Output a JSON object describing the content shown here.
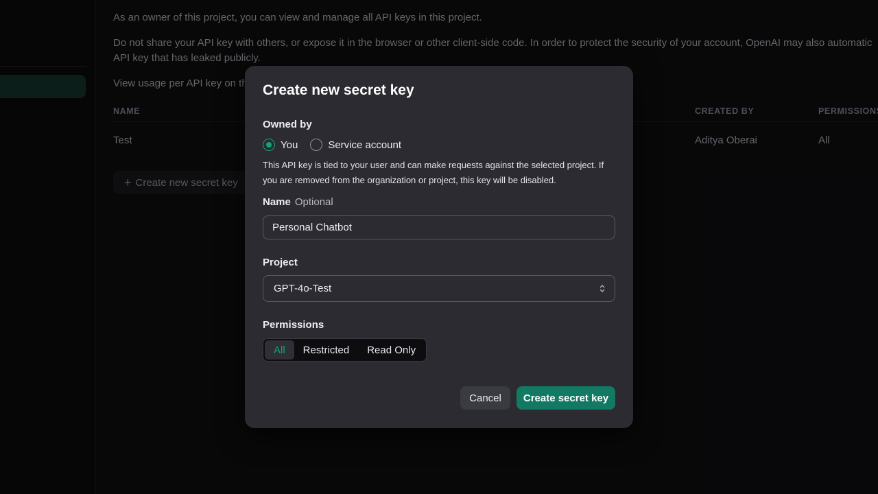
{
  "background": {
    "intro_1": "As an owner of this project, you can view and manage all API keys in this project.",
    "intro_2a": "Do not share your API key with others, or expose it in the browser or other client-side code. In order to protect the security of your account, OpenAI may also automatic",
    "intro_2b": "API key that has leaked publicly.",
    "intro_3": "View usage per API key on th",
    "table": {
      "headers": {
        "name": "NAME",
        "created_by": "CREATED BY",
        "permissions": "PERMISSIONS"
      },
      "rows": [
        {
          "name": "Test",
          "created_by": "Aditya Oberai",
          "permissions": "All"
        }
      ]
    },
    "create_button_label": "Create new secret key"
  },
  "modal": {
    "title": "Create new secret key",
    "owned_by": {
      "label": "Owned by",
      "options": [
        "You",
        "Service account"
      ],
      "selected": "You",
      "help": "This API key is tied to your user and can make requests against the selected project. If you are removed from the organization or project, this key will be disabled."
    },
    "name": {
      "label": "Name",
      "optional": "Optional",
      "value": "Personal Chatbot"
    },
    "project": {
      "label": "Project",
      "value": "GPT-4o-Test"
    },
    "permissions": {
      "label": "Permissions",
      "options": [
        "All",
        "Restricted",
        "Read Only"
      ],
      "selected": "All"
    },
    "actions": {
      "cancel": "Cancel",
      "submit": "Create secret key"
    }
  },
  "colors": {
    "accent": "#10a37f",
    "primary_button": "#127a63",
    "modal_bg": "#2b2b31"
  }
}
